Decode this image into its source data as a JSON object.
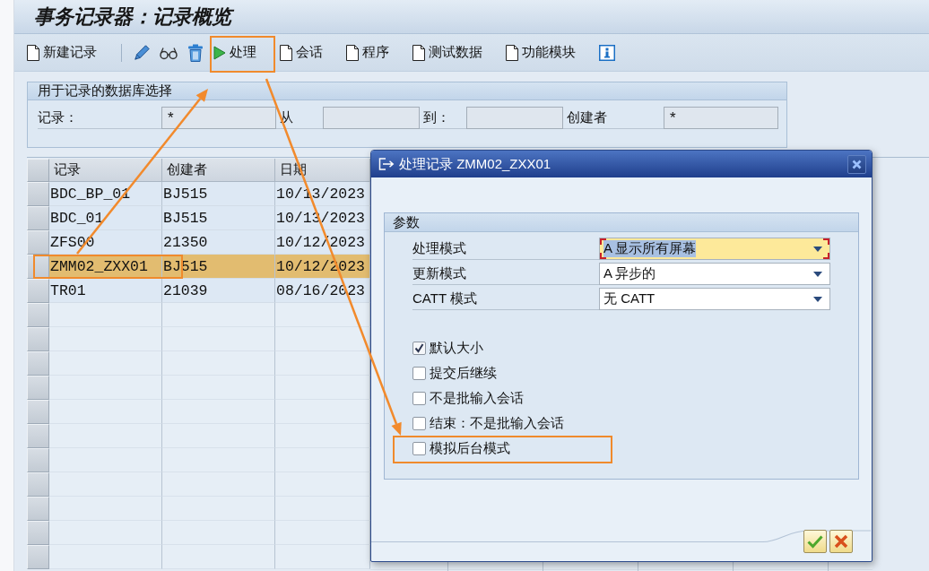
{
  "title": "事务记录器：记录概览",
  "toolbar": [
    {
      "kind": "document",
      "label": "新建记录",
      "annotated": false
    },
    {
      "kind": "separator",
      "annotated": false
    },
    {
      "kind": "pencil",
      "annotated": false
    },
    {
      "kind": "glasses",
      "annotated": false
    },
    {
      "kind": "trash",
      "annotated": false
    },
    {
      "kind": "play",
      "label": "处理",
      "annotated": true
    },
    {
      "kind": "document",
      "label": "会话",
      "annotated": false
    },
    {
      "kind": "document",
      "label": "程序",
      "annotated": false
    },
    {
      "kind": "document",
      "label": "测试数据",
      "annotated": false
    },
    {
      "kind": "document",
      "label": "功能模块",
      "annotated": false
    },
    {
      "kind": "info",
      "annotated": false
    }
  ],
  "selection": {
    "title": "用于记录的数据库选择",
    "fields": [
      {
        "label": "记录：",
        "value": "*"
      },
      {
        "label": "从"
      },
      {
        "label": "到："
      },
      {
        "label": "创建者",
        "value": "*"
      }
    ]
  },
  "table": {
    "columns": [
      "记录",
      "创建者",
      "日期"
    ],
    "rows": [
      {
        "cells": [
          "BDC_BP_01",
          "BJ515",
          "10/13/2023"
        ],
        "selected": false,
        "annotated": false
      },
      {
        "cells": [
          "BDC_01",
          "BJ515",
          "10/13/2023"
        ],
        "selected": false,
        "annotated": false
      },
      {
        "cells": [
          "ZFS00",
          "21350",
          "10/12/2023"
        ],
        "selected": false,
        "annotated": false
      },
      {
        "cells": [
          "ZMM02_ZXX01",
          "BJ515",
          "10/12/2023"
        ],
        "selected": true,
        "annotated": true
      },
      {
        "cells": [
          "TR01",
          "21039",
          "08/16/2023"
        ],
        "selected": false,
        "annotated": false
      }
    ]
  },
  "dialog": {
    "title": "处理记录 ZMM02_ZXX01",
    "group": {
      "title": "参数",
      "dropdowns": [
        {
          "label": "处理模式",
          "value": "A 显示所有屏幕",
          "focused": true
        },
        {
          "label": "更新模式",
          "value": "A 异步的",
          "focused": false
        },
        {
          "label": "CATT 模式",
          "value": "无 CATT",
          "focused": false
        }
      ],
      "checkboxes": [
        {
          "label": "默认大小",
          "checked": true,
          "annotated": false
        },
        {
          "label": "提交后继续",
          "checked": false,
          "annotated": false
        },
        {
          "label": "不是批输入会话",
          "checked": false,
          "annotated": false
        },
        {
          "label": "结束：不是批输入会话",
          "checked": false,
          "annotated": false
        },
        {
          "label": "模拟后台模式",
          "checked": false,
          "annotated": true
        }
      ]
    },
    "buttons": [
      {
        "kind": "confirm"
      },
      {
        "kind": "cancel"
      }
    ]
  }
}
